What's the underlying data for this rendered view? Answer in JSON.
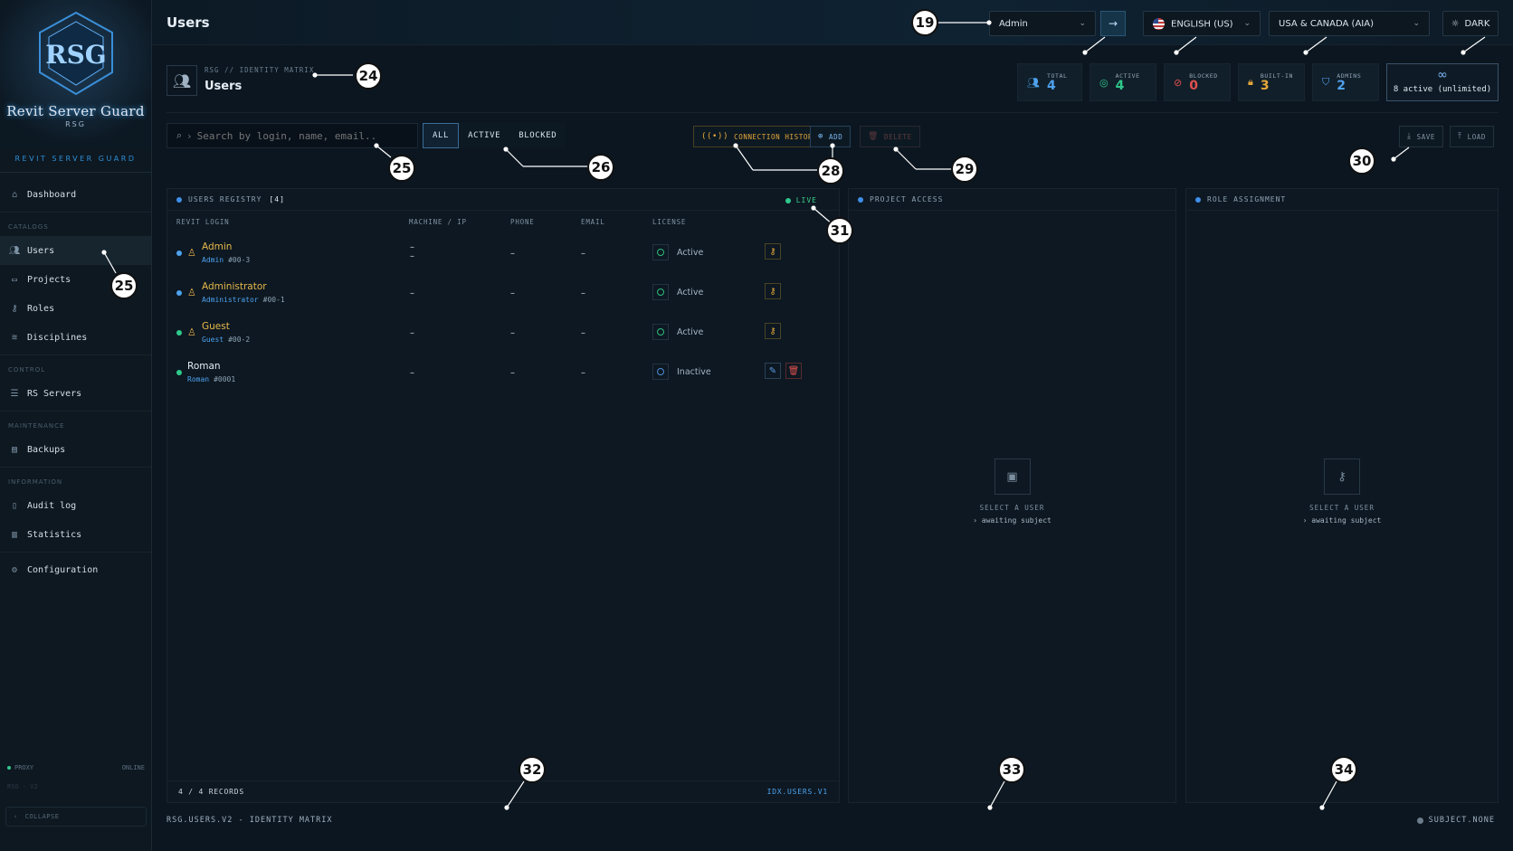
{
  "brand": {
    "title": "Revit Server Guard",
    "mark": "RSG",
    "caption": "REVIT SERVER GUARD",
    "accent": "#3aa6ff"
  },
  "sidebar": {
    "items": [
      {
        "section": "",
        "label": "Dashboard",
        "icon": "home-icon"
      },
      {
        "section": "CATALOGS",
        "label": "Users",
        "icon": "users-icon",
        "active": true
      },
      {
        "section": "",
        "label": "Projects",
        "icon": "folder-icon"
      },
      {
        "section": "",
        "label": "Roles",
        "icon": "key-icon"
      },
      {
        "section": "",
        "label": "Disciplines",
        "icon": "layers-icon"
      },
      {
        "section": "CONTROL",
        "label": "RS Servers",
        "icon": "server-icon"
      },
      {
        "section": "MAINTENANCE",
        "label": "Backups",
        "icon": "archive-icon"
      },
      {
        "section": "INFORMATION",
        "label": "Audit log",
        "icon": "document-icon"
      },
      {
        "section": "",
        "label": "Statistics",
        "icon": "bar-chart-icon"
      },
      {
        "section": "",
        "label": "Configuration",
        "icon": "gear-icon"
      }
    ],
    "proxy_label": "PROXY",
    "proxy_status": "ONLINE",
    "version": "RSG · V2",
    "collapse_label": "COLLAPSE"
  },
  "topbar": {
    "title": "Users",
    "user_select": "Admin",
    "language": "ENGLISH (US)",
    "region": "USA & CANADA (AIA)",
    "theme": "DARK"
  },
  "header": {
    "breadcrumb": "RSG // IDENTITY MATRIX",
    "title": "Users",
    "stats": [
      {
        "label": "TOTAL",
        "value": "4",
        "color": "#4ea2ee",
        "icon": "users-icon"
      },
      {
        "label": "ACTIVE",
        "value": "4",
        "color": "#2fc98b",
        "icon": "check-circle-icon"
      },
      {
        "label": "BLOCKED",
        "value": "0",
        "color": "#e0514e",
        "icon": "ban-icon"
      },
      {
        "label": "BUILT-IN",
        "value": "3",
        "color": "#e6a83a",
        "icon": "lock-icon"
      },
      {
        "label": "ADMINS",
        "value": "2",
        "color": "#4ea2ee",
        "icon": "shield-icon"
      }
    ],
    "license": "8 active (unlimited)"
  },
  "toolbar": {
    "search_placeholder": "Search by login, name, email..",
    "filters": [
      "ALL",
      "ACTIVE",
      "BLOCKED"
    ],
    "connection_history": "CONNECTION HISTORY",
    "add": "ADD",
    "delete": "DELETE",
    "save": "SAVE",
    "load": "LOAD"
  },
  "registry": {
    "title": "USERS REGISTRY",
    "count": "[4]",
    "live": "LIVE",
    "columns": [
      "REVIT LOGIN",
      "MACHINE / IP",
      "PHONE",
      "EMAIL",
      "LICENSE"
    ],
    "rows": [
      {
        "name": "Admin",
        "login": "Admin",
        "id": "#00-3",
        "machine": "–\n–",
        "phone": "–",
        "email": "–",
        "license": "Active",
        "dot": "#4ea2ee",
        "builtin": true
      },
      {
        "name": "Administrator",
        "login": "Administrator",
        "id": "#00-1",
        "machine": "–",
        "phone": "–",
        "email": "–",
        "license": "Active",
        "dot": "#4ea2ee",
        "builtin": true
      },
      {
        "name": "Guest",
        "login": "Guest",
        "id": "#00-2",
        "machine": "–",
        "phone": "–",
        "email": "–",
        "license": "Active",
        "dot": "#2fc98b",
        "builtin": true
      },
      {
        "name": "Roman",
        "login": "Roman",
        "id": "#0001",
        "machine": "–",
        "phone": "–",
        "email": "–",
        "license": "Inactive",
        "dot": "#2fc98b",
        "builtin": false
      }
    ],
    "footer_left": "4 / 4 RECORDS",
    "footer_right": "IDX.USERS.V1"
  },
  "project_access": {
    "title": "PROJECT ACCESS",
    "empty_title": "SELECT A USER",
    "empty_sub": "› awaiting subject"
  },
  "role_assignment": {
    "title": "ROLE ASSIGNMENT",
    "empty_title": "SELECT A USER",
    "empty_sub": "› awaiting subject"
  },
  "statusbar": {
    "left": "RSG.USERS.V2 - IDENTITY MATRIX",
    "right": "SUBJECT.NONE"
  },
  "callouts": [
    "19",
    "24",
    "25",
    "25",
    "26",
    "28",
    "29",
    "30",
    "31",
    "32",
    "33",
    "34"
  ]
}
